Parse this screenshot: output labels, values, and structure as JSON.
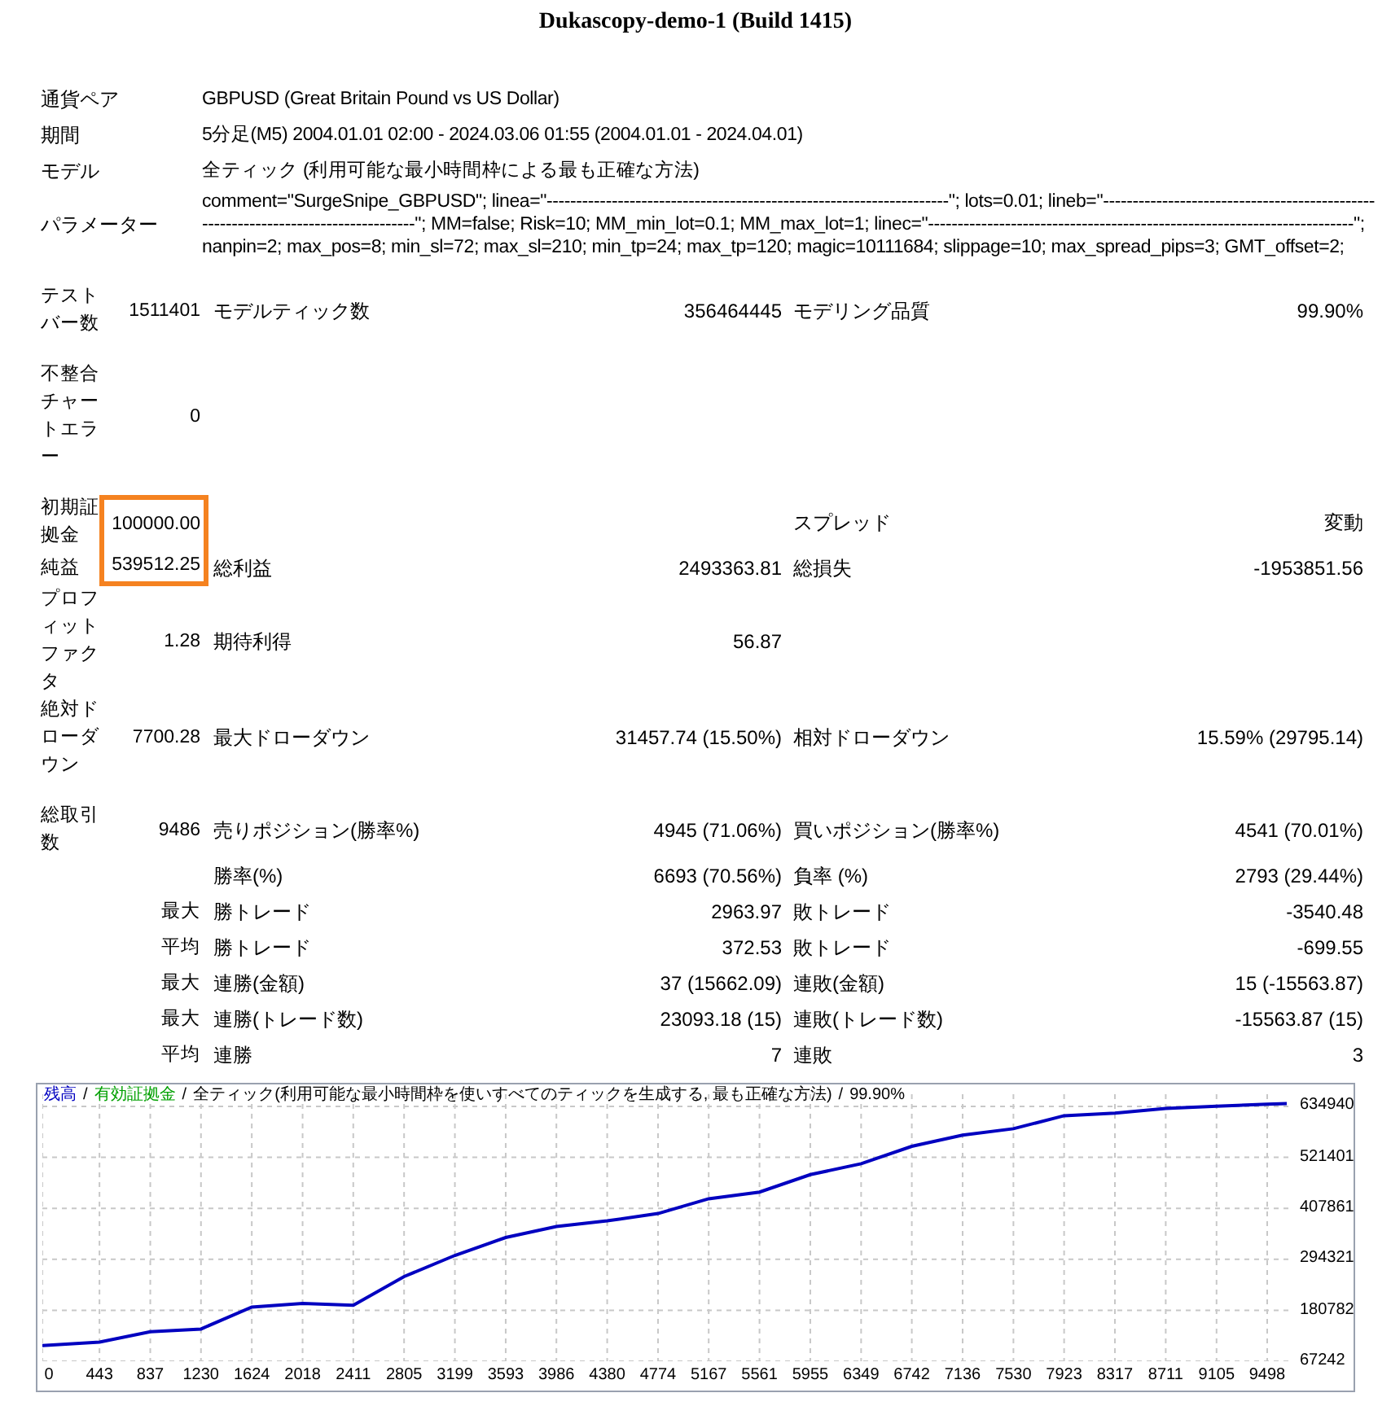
{
  "header": {
    "server": "Dukascopy-demo-1 (Build 1415)"
  },
  "info": [
    {
      "label": "通貨ペア",
      "value": "GBPUSD (Great Britain Pound vs US Dollar)"
    },
    {
      "label": "期間",
      "value": "5分足(M5) 2004.01.01 02:00 - 2024.03.06 01:55 (2004.01.01 - 2024.04.01)"
    },
    {
      "label": "モデル",
      "value": "全ティック (利用可能な最小時間枠による最も正確な方法)"
    },
    {
      "label": "パラメーター",
      "value": "comment=\"SurgeSnipe_GBPUSD\"; linea=\"--------------------------------------------------------------------\"; lots=0.01; lineb=\"----------------------------------------------------------------------------------\"; MM=false; Risk=10; MM_min_lot=0.1; MM_max_lot=1; linec=\"------------------------------------------------------------------------\"; nanpin=2; max_pos=8; min_sl=72; max_sl=210; min_tp=24; max_tp=120; magic=10111684; slippage=10; max_spread_pips=3; GMT_offset=2;"
    }
  ],
  "stats": [
    {
      "label": "テストバー数",
      "value": "1511401",
      "label2": "モデルティック数",
      "value2": "356464445",
      "label3": "モデリング品質",
      "value3": "99.90%",
      "highlighted": false,
      "gap": true
    },
    {
      "label": "不整合チャートエラー",
      "value": "0",
      "highlighted": false,
      "gap": true
    },
    {
      "label": "初期証拠金",
      "value": "100000.00",
      "label3": "スプレッド",
      "value3": "変動",
      "highlighted": true,
      "gap": false
    },
    {
      "label": "純益",
      "value": "539512.25",
      "label2": "総利益",
      "value2": "2493363.81",
      "label3": "総損失",
      "value3": "-1953851.56",
      "highlighted": true,
      "gap": false
    },
    {
      "label": "プロフィットファクタ",
      "value": "1.28",
      "label2": "期待利得",
      "value2": "56.87",
      "highlighted": false,
      "gap": false
    },
    {
      "label": "絶対ドローダウン",
      "value": "7700.28",
      "label2": "最大ドローダウン",
      "value2": "31457.74 (15.50%)",
      "label3": "相対ドローダウン",
      "value3": "15.59% (29795.14)",
      "highlighted": false,
      "gap": true
    },
    {
      "label": "総取引数",
      "value": "9486",
      "label2": "売りポジション(勝率%)",
      "value2": "4945 (71.06%)",
      "label3": "買いポジション(勝率%)",
      "value3": "4541 (70.01%)",
      "highlighted": false,
      "gap": false
    },
    {
      "label2": "勝率(%)",
      "value2": "6693 (70.56%)",
      "label3": "負率 (%)",
      "value3": "2793 (29.44%)",
      "highlighted": false,
      "gap": false
    },
    {
      "value": "最大",
      "label2": "勝トレード",
      "value2": "2963.97",
      "label3": "敗トレード",
      "value3": "-3540.48",
      "highlighted": false,
      "gap": false
    },
    {
      "value": "平均",
      "label2": "勝トレード",
      "value2": "372.53",
      "label3": "敗トレード",
      "value3": "-699.55",
      "highlighted": false,
      "gap": false
    },
    {
      "value": "最大",
      "label2": "連勝(金額)",
      "value2": "37 (15662.09)",
      "label3": "連敗(金額)",
      "value3": "15 (-15563.87)",
      "highlighted": false,
      "gap": false
    },
    {
      "value": "最大",
      "label2": "連勝(トレード数)",
      "value2": "23093.18 (15)",
      "label3": "連敗(トレード数)",
      "value3": "-15563.87 (15)",
      "highlighted": false,
      "gap": false
    },
    {
      "value": "平均",
      "label2": "連勝",
      "value2": "7",
      "label3": "連敗",
      "value3": "3",
      "highlighted": false,
      "gap": false
    }
  ],
  "chart": {
    "separator": "/",
    "legend": [
      {
        "text": "有効証拠金",
        "color": "#00a000"
      },
      {
        "text": "全ティック(利用可能な最小時間枠を使いすべてのティックを生成する, 最も正確な方法)",
        "color": "#000000"
      },
      {
        "text": "99.90%",
        "color": "#000000"
      }
    ],
    "chart_data": {
      "type": "line",
      "grid": true,
      "xlim": [
        0,
        9700
      ],
      "ylim": [
        67242,
        662000
      ],
      "x": [
        0,
        443,
        837,
        1230,
        1624,
        2018,
        2411,
        2805,
        3199,
        3593,
        3986,
        4380,
        4774,
        5167,
        5561,
        5955,
        6349,
        6742,
        7136,
        7530,
        7923,
        8317,
        8711,
        9105,
        9498,
        9650
      ],
      "series": [
        {
          "name": "残高",
          "color": "#0000c0",
          "values": [
            102000,
            110000,
            133000,
            139000,
            188000,
            196000,
            192000,
            256000,
            303000,
            343000,
            367000,
            380000,
            396000,
            429000,
            444000,
            483000,
            507000,
            546000,
            571000,
            585000,
            614000,
            620000,
            630000,
            635000,
            640000,
            641000
          ]
        }
      ],
      "xticks": [
        {
          "value": 0,
          "label": "0"
        },
        {
          "value": 443,
          "label": "443"
        },
        {
          "value": 837,
          "label": "837"
        },
        {
          "value": 1230,
          "label": "1230"
        },
        {
          "value": 1624,
          "label": "1624"
        },
        {
          "value": 2018,
          "label": "2018"
        },
        {
          "value": 2411,
          "label": "2411"
        },
        {
          "value": 2805,
          "label": "2805"
        },
        {
          "value": 3199,
          "label": "3199"
        },
        {
          "value": 3593,
          "label": "3593"
        },
        {
          "value": 3986,
          "label": "3986"
        },
        {
          "value": 4380,
          "label": "4380"
        },
        {
          "value": 4774,
          "label": "4774"
        },
        {
          "value": 5167,
          "label": "5167"
        },
        {
          "value": 5561,
          "label": "5561"
        },
        {
          "value": 5955,
          "label": "5955"
        },
        {
          "value": 6349,
          "label": "6349"
        },
        {
          "value": 6742,
          "label": "6742"
        },
        {
          "value": 7136,
          "label": "7136"
        },
        {
          "value": 7530,
          "label": "7530"
        },
        {
          "value": 7923,
          "label": "7923"
        },
        {
          "value": 8317,
          "label": "8317"
        },
        {
          "value": 8711,
          "label": "8711"
        },
        {
          "value": 9105,
          "label": "9105"
        },
        {
          "value": 9498,
          "label": "9498"
        }
      ],
      "yticks": [
        {
          "value": 67242,
          "label": "67242"
        },
        {
          "value": 180782,
          "label": "180782"
        },
        {
          "value": 294321,
          "label": "294321"
        },
        {
          "value": 407861,
          "label": "407861"
        },
        {
          "value": 521401,
          "label": "521401"
        },
        {
          "value": 634940,
          "label": "634940"
        }
      ]
    }
  }
}
